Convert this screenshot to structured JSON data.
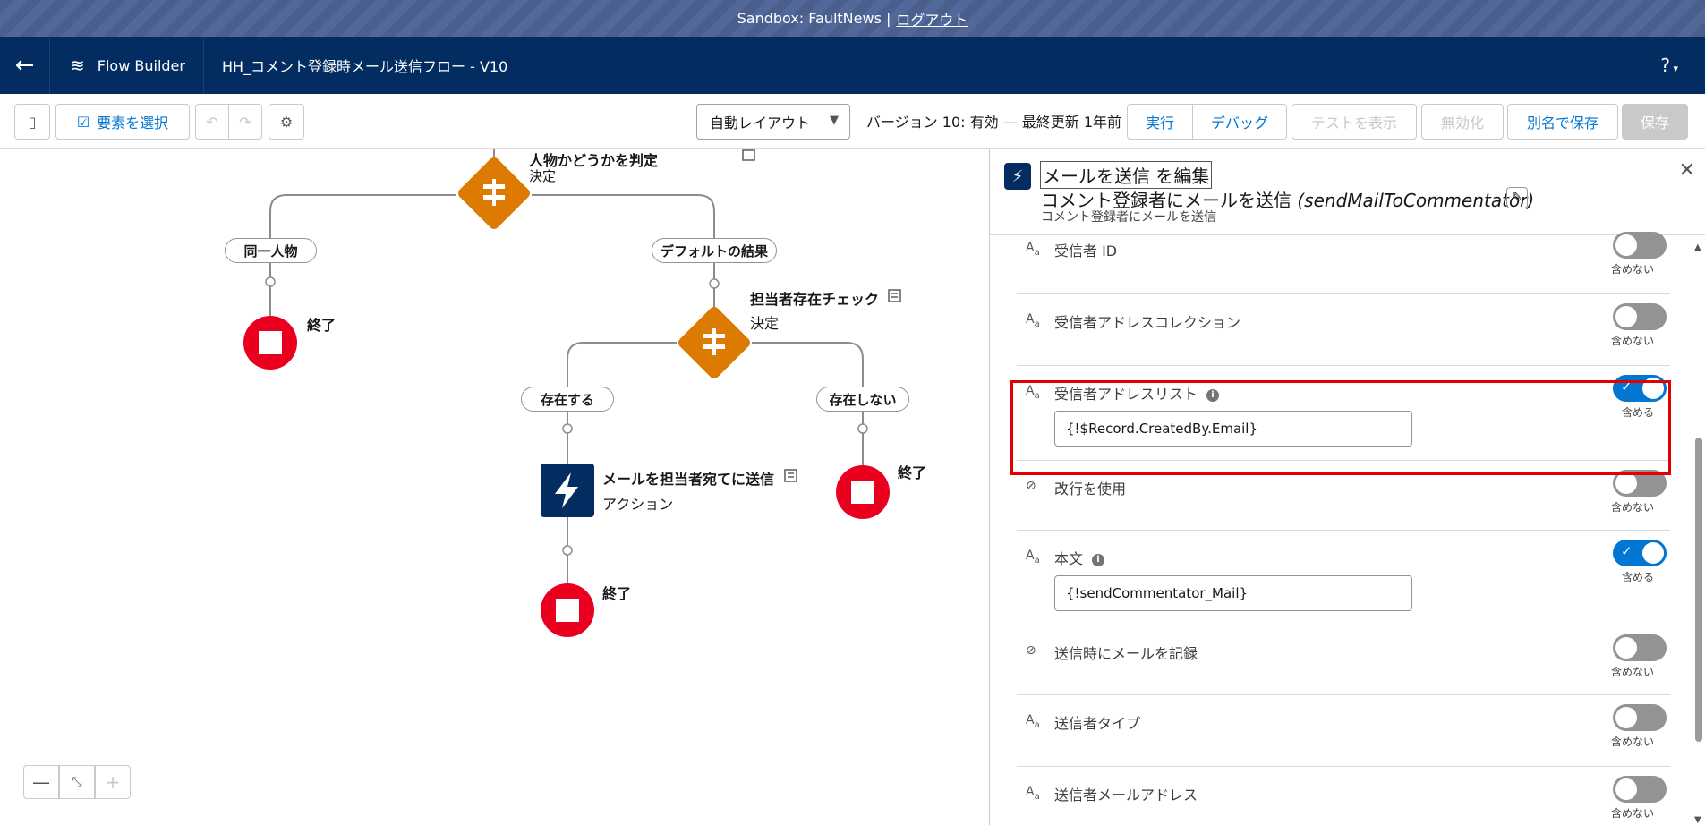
{
  "sandbox": {
    "text": "Sandbox: FaultNews |",
    "logout": "ログアウト"
  },
  "header": {
    "app_name": "Flow Builder",
    "flow_title": "HH_コメント登録時メール送信フロー - V10",
    "help": "?"
  },
  "toolbar": {
    "select_elements": "要素を選択",
    "layout": "自動レイアウト",
    "version": "バージョン 10: 有効 — 最終更新 1年前",
    "run": "実行",
    "debug": "デバッグ",
    "show_tests": "テストを表示",
    "deactivate": "無効化",
    "save_as": "別名で保存",
    "save": "保存"
  },
  "canvas": {
    "decision1_label": "人物かどうかを判定",
    "decision1_type": "決定",
    "branch_same": "同一人物",
    "branch_default": "デフォルトの結果",
    "end1": "終了",
    "decision2_label": "担当者存在チェック",
    "decision2_type": "決定",
    "branch_exists": "存在する",
    "branch_not_exists": "存在しない",
    "action_label": "メールを担当者宛てに送信",
    "action_type": "アクション",
    "end2": "終了",
    "end3": "終了"
  },
  "panel": {
    "title": "メールを送信 を編集",
    "subtitle_main": "コメント登録者にメールを送信 ",
    "subtitle_api": "(sendMailToCommentator)",
    "description": "コメント登録者にメールを送信",
    "params": [
      {
        "type": "Aa",
        "label": "受信者 ID",
        "on": false,
        "status": "含めない",
        "value": ""
      },
      {
        "type": "Aa",
        "label": "受信者アドレスコレクション",
        "on": false,
        "status": "含めない",
        "value": ""
      },
      {
        "type": "Aa",
        "label": "受信者アドレスリスト",
        "on": true,
        "status": "含める",
        "value": "{!$Record.CreatedBy.Email}"
      },
      {
        "type": "bool",
        "label": "改行を使用",
        "on": false,
        "status": "含めない",
        "value": ""
      },
      {
        "type": "Aa",
        "label": "本文",
        "on": true,
        "status": "含める",
        "value": "{!sendCommentator_Mail}"
      },
      {
        "type": "bool",
        "label": "送信時にメールを記録",
        "on": false,
        "status": "含めない",
        "value": ""
      },
      {
        "type": "Aa",
        "label": "送信者タイプ",
        "on": false,
        "status": "含めない",
        "value": ""
      },
      {
        "type": "Aa",
        "label": "送信者メールアドレス",
        "on": false,
        "status": "含めない",
        "value": ""
      }
    ]
  },
  "colors": {
    "header_bg": "#032d60",
    "brand_blue": "#0176d3",
    "decision": "#dd7a01",
    "end": "#ea001e",
    "highlight": "#e50000"
  }
}
